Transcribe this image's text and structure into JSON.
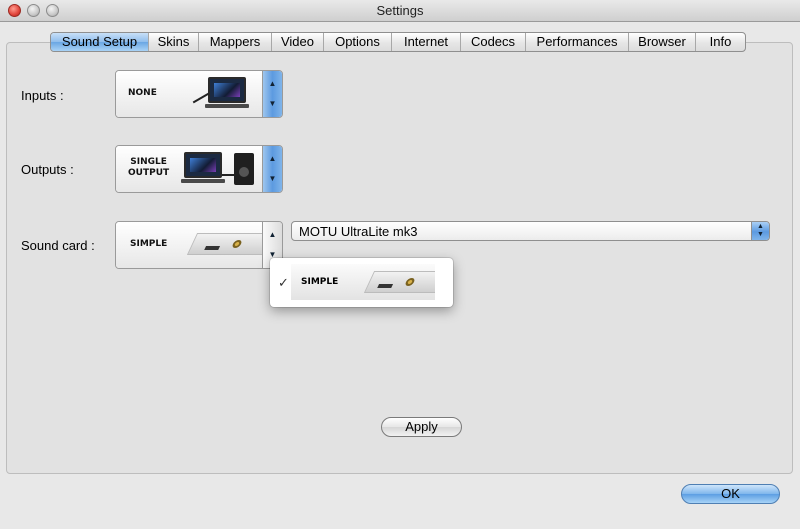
{
  "window": {
    "title": "Settings"
  },
  "tabs": [
    {
      "label": "Sound Setup",
      "active": true
    },
    {
      "label": "Skins"
    },
    {
      "label": "Mappers"
    },
    {
      "label": "Video"
    },
    {
      "label": "Options"
    },
    {
      "label": "Internet"
    },
    {
      "label": "Codecs"
    },
    {
      "label": "Performances"
    },
    {
      "label": "Browser"
    },
    {
      "label": "Info"
    }
  ],
  "inputs": {
    "label": "Inputs :",
    "value": "NONE"
  },
  "outputs": {
    "label": "Outputs :",
    "value_line1": "SINGLE",
    "value_line2": "OUTPUT"
  },
  "soundcard": {
    "label": "Sound card :",
    "value": "SIMPLE",
    "device": "MOTU UltraLite mk3",
    "menu": {
      "items": [
        {
          "label": "SIMPLE",
          "checked": true,
          "check_glyph": "✓"
        }
      ]
    }
  },
  "buttons": {
    "apply": "Apply",
    "ok": "OK"
  },
  "icons": {
    "stepper_up": "▲",
    "stepper_down": "▼",
    "popup": "chevron-updown-icon"
  },
  "colors": {
    "accent": "#6aa6e3",
    "window_bg": "#e8e8e8"
  }
}
